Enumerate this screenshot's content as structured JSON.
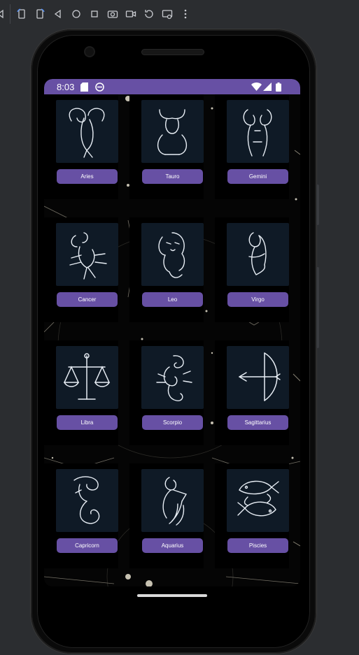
{
  "emulator_toolbar": {
    "icons": [
      "volume-icon",
      "rotate-left-icon",
      "rotate-right-icon",
      "back-icon",
      "home-icon",
      "overview-icon",
      "screenshot-icon",
      "record-icon",
      "rewind-icon",
      "camera-settings-icon",
      "more-icon"
    ]
  },
  "status_bar": {
    "time": "8:03",
    "background": "#6750a4",
    "left_icons": [
      "sd-card-icon",
      "sync-icon"
    ],
    "right_icons": [
      "wifi-icon",
      "signal-icon",
      "battery-icon"
    ]
  },
  "zodiac": {
    "accent": "#6750a4",
    "signs": [
      {
        "label": "Aries",
        "icon": "aries-icon"
      },
      {
        "label": "Tauro",
        "icon": "taurus-icon"
      },
      {
        "label": "Gemini",
        "icon": "gemini-icon"
      },
      {
        "label": "Cancer",
        "icon": "cancer-icon"
      },
      {
        "label": "Leo",
        "icon": "leo-icon"
      },
      {
        "label": "Virgo",
        "icon": "virgo-icon"
      },
      {
        "label": "Libra",
        "icon": "libra-icon"
      },
      {
        "label": "Scorpio",
        "icon": "scorpio-icon"
      },
      {
        "label": "Sagittarius",
        "icon": "sagittarius-icon"
      },
      {
        "label": "Capricorn",
        "icon": "capricorn-icon"
      },
      {
        "label": "Aquarius",
        "icon": "aquarius-icon"
      },
      {
        "label": "Piscies",
        "icon": "pisces-icon"
      }
    ]
  }
}
